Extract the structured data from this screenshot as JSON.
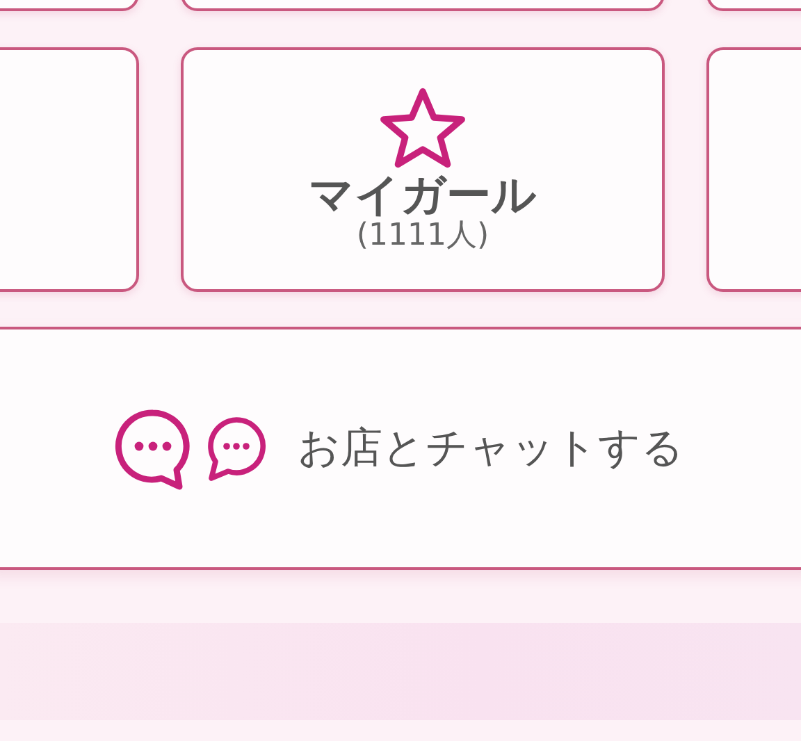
{
  "tile": {
    "label": "マイガール",
    "count": "(1111人)"
  },
  "chat_button": {
    "label": "お店とチャットする"
  }
}
